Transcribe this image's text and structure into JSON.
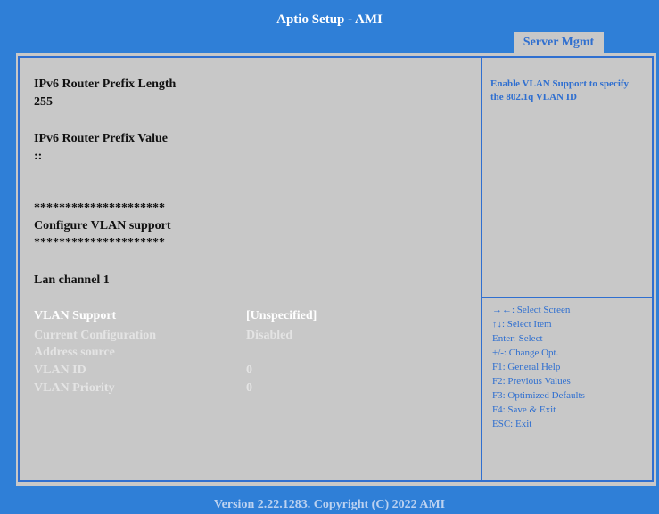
{
  "title": "Aptio Setup  - AMI",
  "tab": "Server Mgmt",
  "content": {
    "prefix_length_label": "IPv6 Router Prefix Length",
    "prefix_length_value": "255",
    "prefix_value_label": "IPv6 Router Prefix Value",
    "prefix_value_value": "::",
    "stars_top": "*********************",
    "section_title": "Configure VLAN support",
    "stars_bottom": "*********************",
    "lan_channel": "Lan channel 1",
    "settings": [
      {
        "label": "VLAN Support",
        "value": "[Unspecified]"
      },
      {
        "label": "Current Configuration",
        "value": "Disabled"
      },
      {
        "label": "Address source",
        "value": ""
      },
      {
        "label": "VLAN ID",
        "value": "0"
      },
      {
        "label": "VLAN Priority",
        "value": "0"
      }
    ]
  },
  "help": {
    "description": "Enable VLAN Support to specify the 802.1q VLAN ID",
    "keys": [
      "→←: Select Screen",
      "↑↓: Select Item",
      "Enter: Select",
      "+/-: Change Opt.",
      "F1: General Help",
      "F2: Previous Values",
      "F3: Optimized Defaults",
      "F4: Save & Exit",
      "ESC: Exit"
    ]
  },
  "footer": "Version 2.22.1283. Copyright (C) 2022 AMI"
}
